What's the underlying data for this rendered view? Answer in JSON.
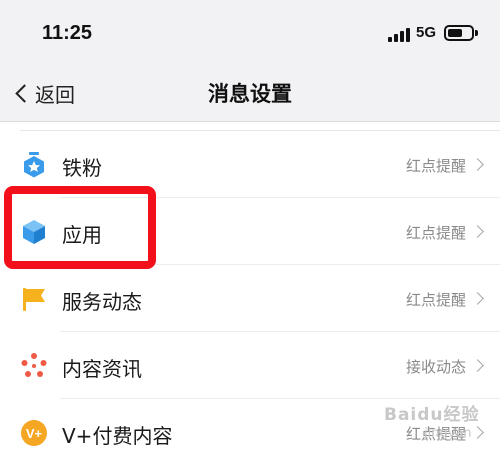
{
  "status_bar": {
    "time": "11:25",
    "network": "5G"
  },
  "nav": {
    "back_label": "返回",
    "title": "消息设置"
  },
  "settings": [
    {
      "label": "铁粉",
      "value": "红点提醒",
      "icon": "fan-badge-icon"
    },
    {
      "label": "应用",
      "value": "红点提醒",
      "icon": "cube-icon"
    },
    {
      "label": "服务动态",
      "value": "红点提醒",
      "icon": "flag-icon"
    },
    {
      "label": "内容资讯",
      "value": "接收动态",
      "icon": "dots-flower-icon"
    },
    {
      "label": "V+付费内容",
      "value": "红点提醒",
      "icon": "vplus-icon"
    }
  ],
  "watermark": {
    "text": "Baidu经验",
    "sub": "jingyan"
  },
  "colors": {
    "highlight": "#f2101a",
    "blue_icon": "#3a9bea",
    "flag": "#f5b21c",
    "flower": "#f05a45",
    "vplus": "#f5a623"
  }
}
